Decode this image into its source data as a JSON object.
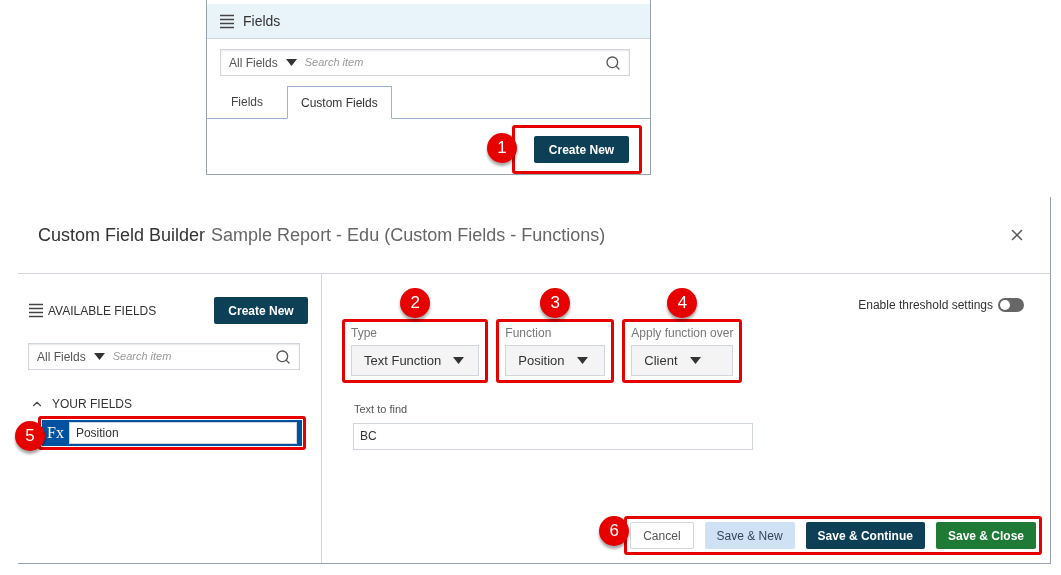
{
  "top_panel": {
    "title": "Fields",
    "filter": {
      "value": "All Fields",
      "placeholder": "Search item"
    },
    "tabs": [
      {
        "label": "Fields",
        "selected": false
      },
      {
        "label": "Custom Fields",
        "selected": true
      }
    ],
    "create_button": "Create New",
    "callout": "1"
  },
  "dialog": {
    "title": "Custom Field Builder",
    "subtitle": "Sample Report - Edu (Custom Fields - Functions)",
    "left": {
      "heading": "AVAILABLE FIELDS",
      "create_button": "Create New",
      "filter": {
        "value": "All Fields",
        "placeholder": "Search item"
      },
      "section": {
        "label": "YOUR FIELDS",
        "expanded": true
      },
      "fields": [
        {
          "icon_text": "Fx",
          "name": "Position",
          "selected": true
        }
      ],
      "callout": "5"
    },
    "right": {
      "threshold": {
        "label": "Enable threshold settings",
        "on": false
      },
      "selects": [
        {
          "label": "Type",
          "value": "Text Function",
          "callout": "2"
        },
        {
          "label": "Function",
          "value": "Position",
          "callout": "3"
        },
        {
          "label": "Apply function over",
          "value": "Client",
          "callout": "4"
        }
      ],
      "text_field": {
        "label": "Text to find",
        "value": "BC"
      }
    },
    "buttons": [
      {
        "label": "Cancel",
        "kind": "outline"
      },
      {
        "label": "Save & New",
        "kind": "light"
      },
      {
        "label": "Save & Continue",
        "kind": "dark"
      },
      {
        "label": "Save & Close",
        "kind": "green"
      }
    ],
    "buttons_callout": "6"
  }
}
